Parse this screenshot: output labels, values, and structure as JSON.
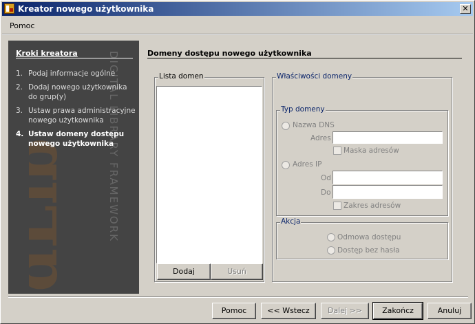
{
  "window": {
    "title": "Kreator nowego użytkownika",
    "close_glyph": "✕"
  },
  "menu": {
    "help": "Pomoc"
  },
  "sidebar": {
    "title": "Kroki kreatora",
    "watermark_text": "DIGITAL LIBRARY FRAMEWORK",
    "steps": [
      {
        "num": "1.",
        "label": "Podaj informacje ogólne"
      },
      {
        "num": "2.",
        "label": "Dodaj nowego użytkownika do grup(y)"
      },
      {
        "num": "3.",
        "label": "Ustaw prawa administracyjne nowego użytkownika"
      },
      {
        "num": "4.",
        "label": "Ustaw domeny dostępu nowego użytkownika"
      }
    ]
  },
  "main": {
    "title": "Domeny dostępu nowego użytkownika",
    "domain_list": {
      "label": "Lista domen",
      "add": "Dodaj",
      "remove": "Usuń"
    },
    "properties": {
      "label": "Właściwości domeny",
      "type_group": {
        "label": "Typ domeny",
        "dns": "Nazwa DNS",
        "address": "Adres",
        "address_value": "",
        "address_mask": "Maska adresów",
        "ip": "Adres IP",
        "from": "Od",
        "from_value": "",
        "to": "Do",
        "to_value": "",
        "range": "Zakres adresów"
      },
      "action_group": {
        "label": "Akcja",
        "deny": "Odmowa dostępu",
        "no_password": "Dostęp bez hasła"
      }
    }
  },
  "buttons": {
    "help": "Pomoc",
    "back": "<< Wstecz",
    "next": "Dalej >>",
    "finish": "Zakończ",
    "cancel": "Anuluj"
  },
  "colors": {
    "title_start": "#0a246a",
    "title_end": "#a6caf0",
    "sidebar_bg": "#444444",
    "face": "#d4d0c8"
  }
}
